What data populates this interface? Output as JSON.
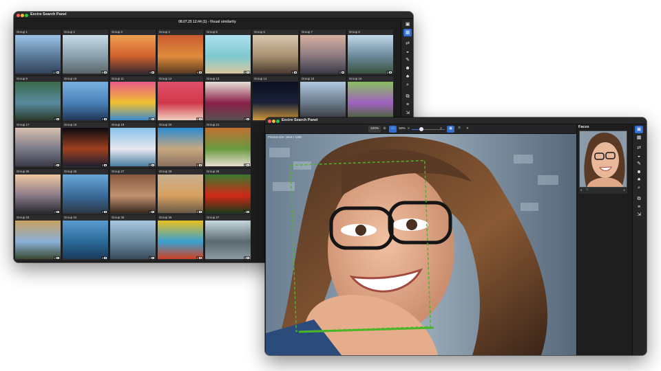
{
  "window1": {
    "title": "Excire Search Panel",
    "subtitle": "08.07.25 12:44 (1) - Visual similarity",
    "groups": [
      {
        "label": "Group 1",
        "count": "12",
        "tone": [
          "#9dc4e8",
          "#5a7a9a",
          "#33425a"
        ]
      },
      {
        "label": "Group 2",
        "count": "6",
        "tone": [
          "#c9dde8",
          "#8aa0ad",
          "#5a6668"
        ]
      },
      {
        "label": "Group 3",
        "count": "3",
        "tone": [
          "#f0a050",
          "#d06030",
          "#3a2a30"
        ]
      },
      {
        "label": "Group 4",
        "count": "3",
        "tone": [
          "#c85a30",
          "#e08c3c",
          "#5a3a20"
        ]
      },
      {
        "label": "Group 5",
        "count": "2",
        "tone": [
          "#aee0f0",
          "#7ec8d0",
          "#d8c8a0"
        ]
      },
      {
        "label": "Group 6",
        "count": "3",
        "tone": [
          "#d8c8b0",
          "#a89070",
          "#4a3a30"
        ]
      },
      {
        "label": "Group 7",
        "count": "2",
        "tone": [
          "#d8b0a0",
          "#8a7a80",
          "#3a3a48"
        ]
      },
      {
        "label": "Group 8",
        "count": "2",
        "tone": [
          "#c0d8e8",
          "#6a8a9a",
          "#3a5040"
        ]
      },
      {
        "label": "Group 9",
        "count": "2",
        "tone": [
          "#3a6a4a",
          "#5a8aa0",
          "#2a3a2a"
        ]
      },
      {
        "label": "Group 10",
        "count": "2",
        "tone": [
          "#7ab0e0",
          "#4a80b8",
          "#203858"
        ]
      },
      {
        "label": "Group 11",
        "count": "2",
        "tone": [
          "#e85a8a",
          "#f0c030",
          "#3a8ad0"
        ]
      },
      {
        "label": "Group 12",
        "count": "2",
        "tone": [
          "#e0506a",
          "#d03848",
          "#f0d0c0"
        ]
      },
      {
        "label": "Group 13",
        "count": "2",
        "tone": [
          "#e8e0d8",
          "#8a2048",
          "#5a5050"
        ]
      },
      {
        "label": "Group 14",
        "count": "2",
        "tone": [
          "#0a1020",
          "#1a2038",
          "#d8a040"
        ]
      },
      {
        "label": "Group 15",
        "count": "2",
        "tone": [
          "#b0c8e0",
          "#6a7a8a",
          "#3a3a40"
        ]
      },
      {
        "label": "Group 16",
        "count": "2",
        "tone": [
          "#8ac060",
          "#a060c0",
          "#4a7030"
        ]
      },
      {
        "label": "Group 17",
        "count": "3",
        "tone": [
          "#d8c0b0",
          "#7a7a88",
          "#3a3a48"
        ]
      },
      {
        "label": "Group 18",
        "count": "2",
        "tone": [
          "#0a0a10",
          "#a04020",
          "#202030"
        ]
      },
      {
        "label": "Group 19",
        "count": "2",
        "tone": [
          "#88c0e8",
          "#e8e8f0",
          "#4a80a0"
        ]
      },
      {
        "label": "Group 20",
        "count": "2",
        "tone": [
          "#2a8ad0",
          "#c8a880",
          "#8a7060"
        ]
      },
      {
        "label": "Group 21",
        "count": "2",
        "tone": [
          "#c07030",
          "#6a9a40",
          "#e8e0d0"
        ]
      },
      {
        "label": "Group 25",
        "count": "2",
        "tone": [
          "#f0c8a0",
          "#8a7a88",
          "#2a2a30"
        ]
      },
      {
        "label": "Group 26",
        "count": "2",
        "tone": [
          "#6aa8d8",
          "#3a6a98",
          "#2a3a4a"
        ]
      },
      {
        "label": "Group 27",
        "count": "2",
        "tone": [
          "#8a5a40",
          "#c09070",
          "#3a2a20"
        ]
      },
      {
        "label": "Group 28",
        "count": "2",
        "tone": [
          "#c8b090",
          "#d8a060",
          "#6a5a48"
        ]
      },
      {
        "label": "Group 29",
        "count": "2",
        "tone": [
          "#3a7a30",
          "#d02818",
          "#1a3a18"
        ]
      },
      {
        "label": "Group 33",
        "count": "2",
        "tone": [
          "#c8a060",
          "#8ab0d8",
          "#3a4a30"
        ]
      },
      {
        "label": "Group 34",
        "count": "2",
        "tone": [
          "#5a9ad0",
          "#2a6a98",
          "#1a3a5a"
        ]
      },
      {
        "label": "Group 35",
        "count": "2",
        "tone": [
          "#a8c8e0",
          "#6a8aa0",
          "#3a4a58"
        ]
      },
      {
        "label": "Group 36",
        "count": "2",
        "tone": [
          "#e8c020",
          "#3aa0d0",
          "#d04020"
        ]
      },
      {
        "label": "Group 37",
        "count": "2",
        "tone": [
          "#c8d8e0",
          "#5a6a70",
          "#8a9aa0"
        ]
      }
    ],
    "right_tools": [
      {
        "name": "layout-single-icon",
        "glyph": "▣",
        "on": false
      },
      {
        "name": "layout-grid-icon",
        "glyph": "▦",
        "on": true
      },
      {
        "name": "similar-search-icon",
        "glyph": "⇄",
        "on": false
      },
      {
        "name": "color-search-icon",
        "glyph": "◒",
        "on": false
      },
      {
        "name": "tag-icon",
        "glyph": "✎",
        "on": false
      },
      {
        "name": "face-icon",
        "glyph": "☻",
        "on": false
      },
      {
        "name": "people-icon",
        "glyph": "♣",
        "on": false
      },
      {
        "name": "search-icon",
        "glyph": "⌕",
        "on": false
      },
      {
        "name": "duplicates-icon",
        "glyph": "⧉",
        "on": false
      },
      {
        "name": "sort-icon",
        "glyph": "≡",
        "on": false
      },
      {
        "name": "export-icon",
        "glyph": "⇲",
        "on": false
      }
    ]
  },
  "window2": {
    "title": "Excire Search Panel",
    "zoom_fit": "100%",
    "zoom_value": "50%",
    "zoom_slider": 0.3,
    "preview_info": "Preview size: 1919 x 1280",
    "faces_title": "Faces",
    "colors": {
      "accent": "#2f6fd6",
      "face_box": "#4bb52a"
    },
    "right_tools": [
      {
        "name": "layout-single-icon",
        "glyph": "▣",
        "on": true
      },
      {
        "name": "layout-grid-icon",
        "glyph": "▦",
        "on": false
      },
      {
        "name": "similar-search-icon",
        "glyph": "⇄",
        "on": false
      },
      {
        "name": "color-search-icon",
        "glyph": "◒",
        "on": false
      },
      {
        "name": "tag-icon",
        "glyph": "✎",
        "on": false
      },
      {
        "name": "face-icon",
        "glyph": "☻",
        "on": false
      },
      {
        "name": "people-icon",
        "glyph": "♣",
        "on": false
      },
      {
        "name": "search-icon",
        "glyph": "⌕",
        "on": false
      },
      {
        "name": "duplicates-icon",
        "glyph": "⧉",
        "on": false
      },
      {
        "name": "sort-icon",
        "glyph": "≡",
        "on": false
      },
      {
        "name": "export-icon",
        "glyph": "⇲",
        "on": false
      }
    ]
  }
}
